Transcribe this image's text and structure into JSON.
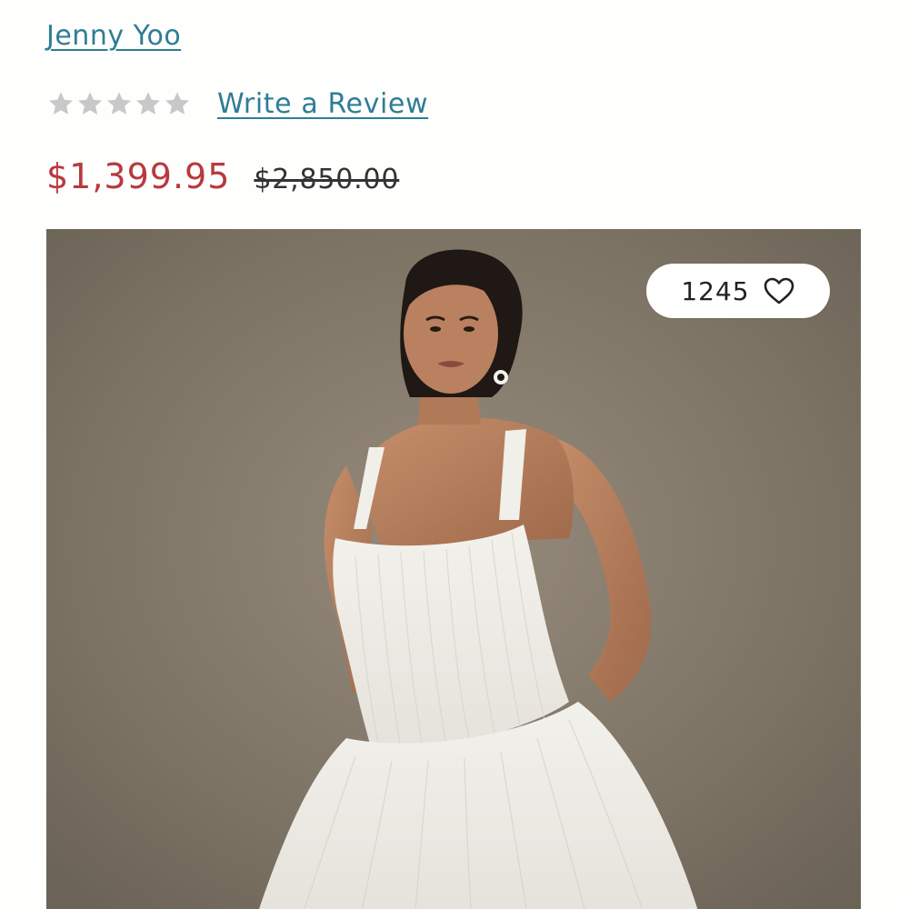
{
  "product": {
    "brand": "Jenny Yoo",
    "review_link": "Write a Review",
    "rating": 0,
    "rating_max": 5,
    "price_sale": "$1,399.95",
    "price_original": "$2,850.00"
  },
  "like": {
    "count": "1245",
    "icon": "heart-outline-icon"
  },
  "colors": {
    "link": "#2f7d96",
    "sale_price": "#b8393f",
    "star_empty": "#c8c8c8",
    "photo_background": "#7d7466"
  }
}
